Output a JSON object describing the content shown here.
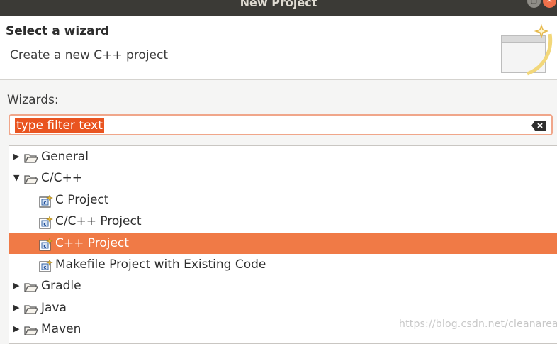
{
  "window": {
    "title": "New Project",
    "maximize_icon": "maximize-icon",
    "close_icon": "close-icon",
    "close_color": "#f0704a"
  },
  "header": {
    "title": "Select a wizard",
    "description": "Create a new C++ project",
    "banner_icon": "new-project-wizard-banner"
  },
  "wizards_label": "Wizards:",
  "filter": {
    "placeholder": "type filter text",
    "clear_icon": "clear-filter-icon"
  },
  "tree": [
    {
      "label": "General",
      "type": "folder",
      "expanded": false
    },
    {
      "label": "C/C++",
      "type": "folder",
      "expanded": true
    },
    {
      "label": "C Project",
      "type": "project"
    },
    {
      "label": "C/C++ Project",
      "type": "project"
    },
    {
      "label": "C++ Project",
      "type": "project",
      "selected": true
    },
    {
      "label": "Makefile Project with Existing Code",
      "type": "project"
    },
    {
      "label": "Gradle",
      "type": "folder",
      "expanded": false
    },
    {
      "label": "Java",
      "type": "folder",
      "expanded": false
    },
    {
      "label": "Maven",
      "type": "folder",
      "expanded": false
    }
  ],
  "selection_color": "#f07a46",
  "watermark": "https://blog.csdn.net/cleanarea"
}
